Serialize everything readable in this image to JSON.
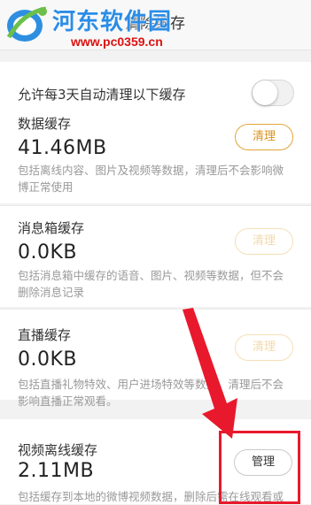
{
  "header": {
    "title": "清除缓存",
    "back_icon": "back-arrow-icon"
  },
  "watermark": {
    "site_name": "河东软件园",
    "url": "www.pc0359.cn"
  },
  "auto_clean": {
    "label": "允许每3天自动清理以下缓存",
    "enabled": false
  },
  "data_cache": {
    "label": "数据缓存",
    "size": "41.46MB",
    "button": "清理",
    "desc": "包括离线内容、图片及视频等数据，清理后不会影响微博正常使用"
  },
  "inbox_cache": {
    "label": "消息箱缓存",
    "size": "0.0KB",
    "button": "清理",
    "desc": "包括消息箱中缓存的语音、图片、视频等数据，但不会删除消息记录"
  },
  "live_cache": {
    "label": "直播缓存",
    "size": "0.0KB",
    "button": "清理",
    "desc": "包括直播礼物特效、用户进场特效等数据，清理后不会影响直播正常观看。"
  },
  "video_cache": {
    "label": "视频离线缓存",
    "size": "2.11MB",
    "button": "管理",
    "desc": "包括缓存到本地的微博视频数据，删除后需在线观看或"
  },
  "colors": {
    "accent": "#d9921d",
    "highlight": "#e8192c",
    "watermark_blue": "#2b8de6"
  }
}
